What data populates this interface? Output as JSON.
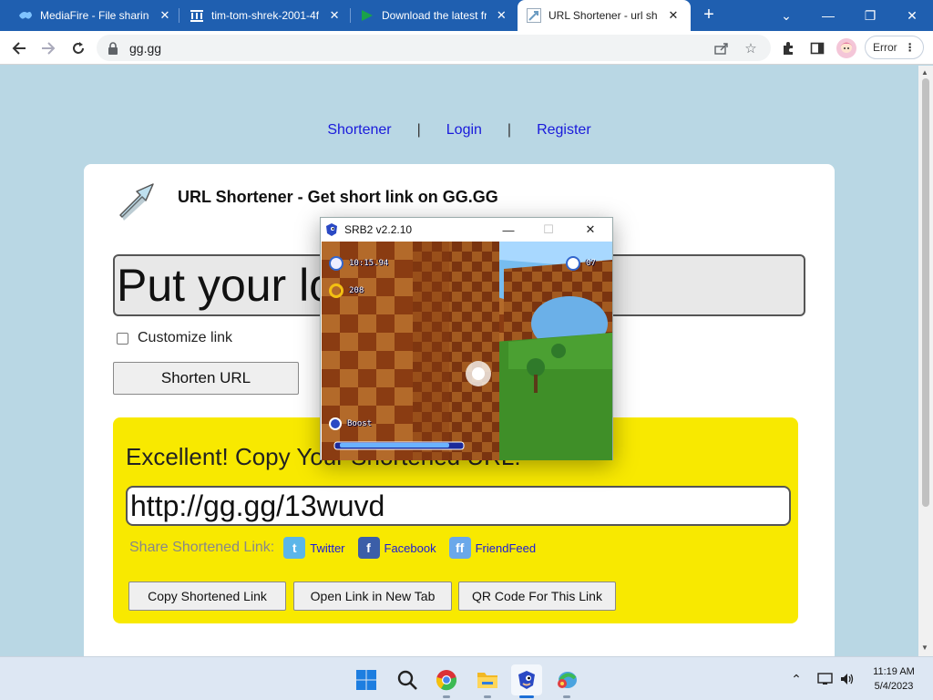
{
  "browser": {
    "tabs": [
      {
        "title": "MediaFire - File sharing",
        "icon": "mediafire-icon"
      },
      {
        "title": "tim-tom-shrek-2001-4f",
        "icon": "archive-icon"
      },
      {
        "title": "Download the latest fr",
        "icon": "play-icon"
      },
      {
        "title": "URL Shortener - url sh",
        "icon": "shortener-icon",
        "active": true
      }
    ],
    "url": "gg.gg",
    "error_label": "Error"
  },
  "nav": {
    "items": [
      "Shortener",
      "Login",
      "Register"
    ]
  },
  "card": {
    "title": "URL Shortener - Get short link on GG.GG",
    "input_text": "Put your long link here...",
    "customize_label": "Customize link",
    "shorten_button": "Shorten URL"
  },
  "result": {
    "title": "Excellent! Copy Your Shortened URL:",
    "short_url": "http://gg.gg/13wuvd",
    "share_label": "Share Shortened Link:",
    "share_links": [
      "Twitter",
      "Facebook",
      "FriendFeed"
    ],
    "buttons": [
      "Copy Shortened Link",
      "Open Link in New Tab",
      "QR Code For This Link"
    ]
  },
  "game": {
    "title": "SRB2 v2.2.10",
    "time": "10:15.94",
    "rings": "208",
    "lives": "07",
    "boost_label": "Boost"
  },
  "taskbar": {
    "time": "11:19 AM",
    "date": "5/4/2023"
  },
  "colors": {
    "tabstrip": "#1f5fb0",
    "page_bg": "#b9d7e4",
    "result_bg": "#f8e900",
    "link": "#1a1adb"
  }
}
